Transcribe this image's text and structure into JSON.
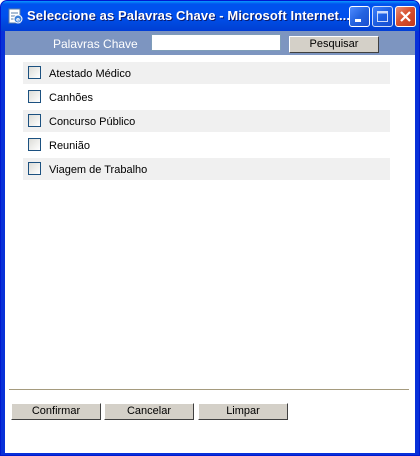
{
  "window": {
    "title": "Seleccione as Palavras Chave - Microsoft Internet..."
  },
  "search": {
    "label": "Palavras Chave",
    "value": "",
    "button_label": "Pesquisar"
  },
  "keywords": [
    {
      "label": "Atestado Médico",
      "checked": false
    },
    {
      "label": "Canhões",
      "checked": false
    },
    {
      "label": "Concurso Público",
      "checked": false
    },
    {
      "label": "Reunião",
      "checked": false
    },
    {
      "label": "Viagem de Trabalho",
      "checked": false
    }
  ],
  "footer": {
    "confirm_label": "Confirmar",
    "cancel_label": "Cancelar",
    "clear_label": "Limpar"
  },
  "colors": {
    "titlebar": "#0050ee",
    "searchbar": "#7d95c0",
    "row_shade": "#f0f0f0",
    "button_face": "#d4d0c8"
  }
}
